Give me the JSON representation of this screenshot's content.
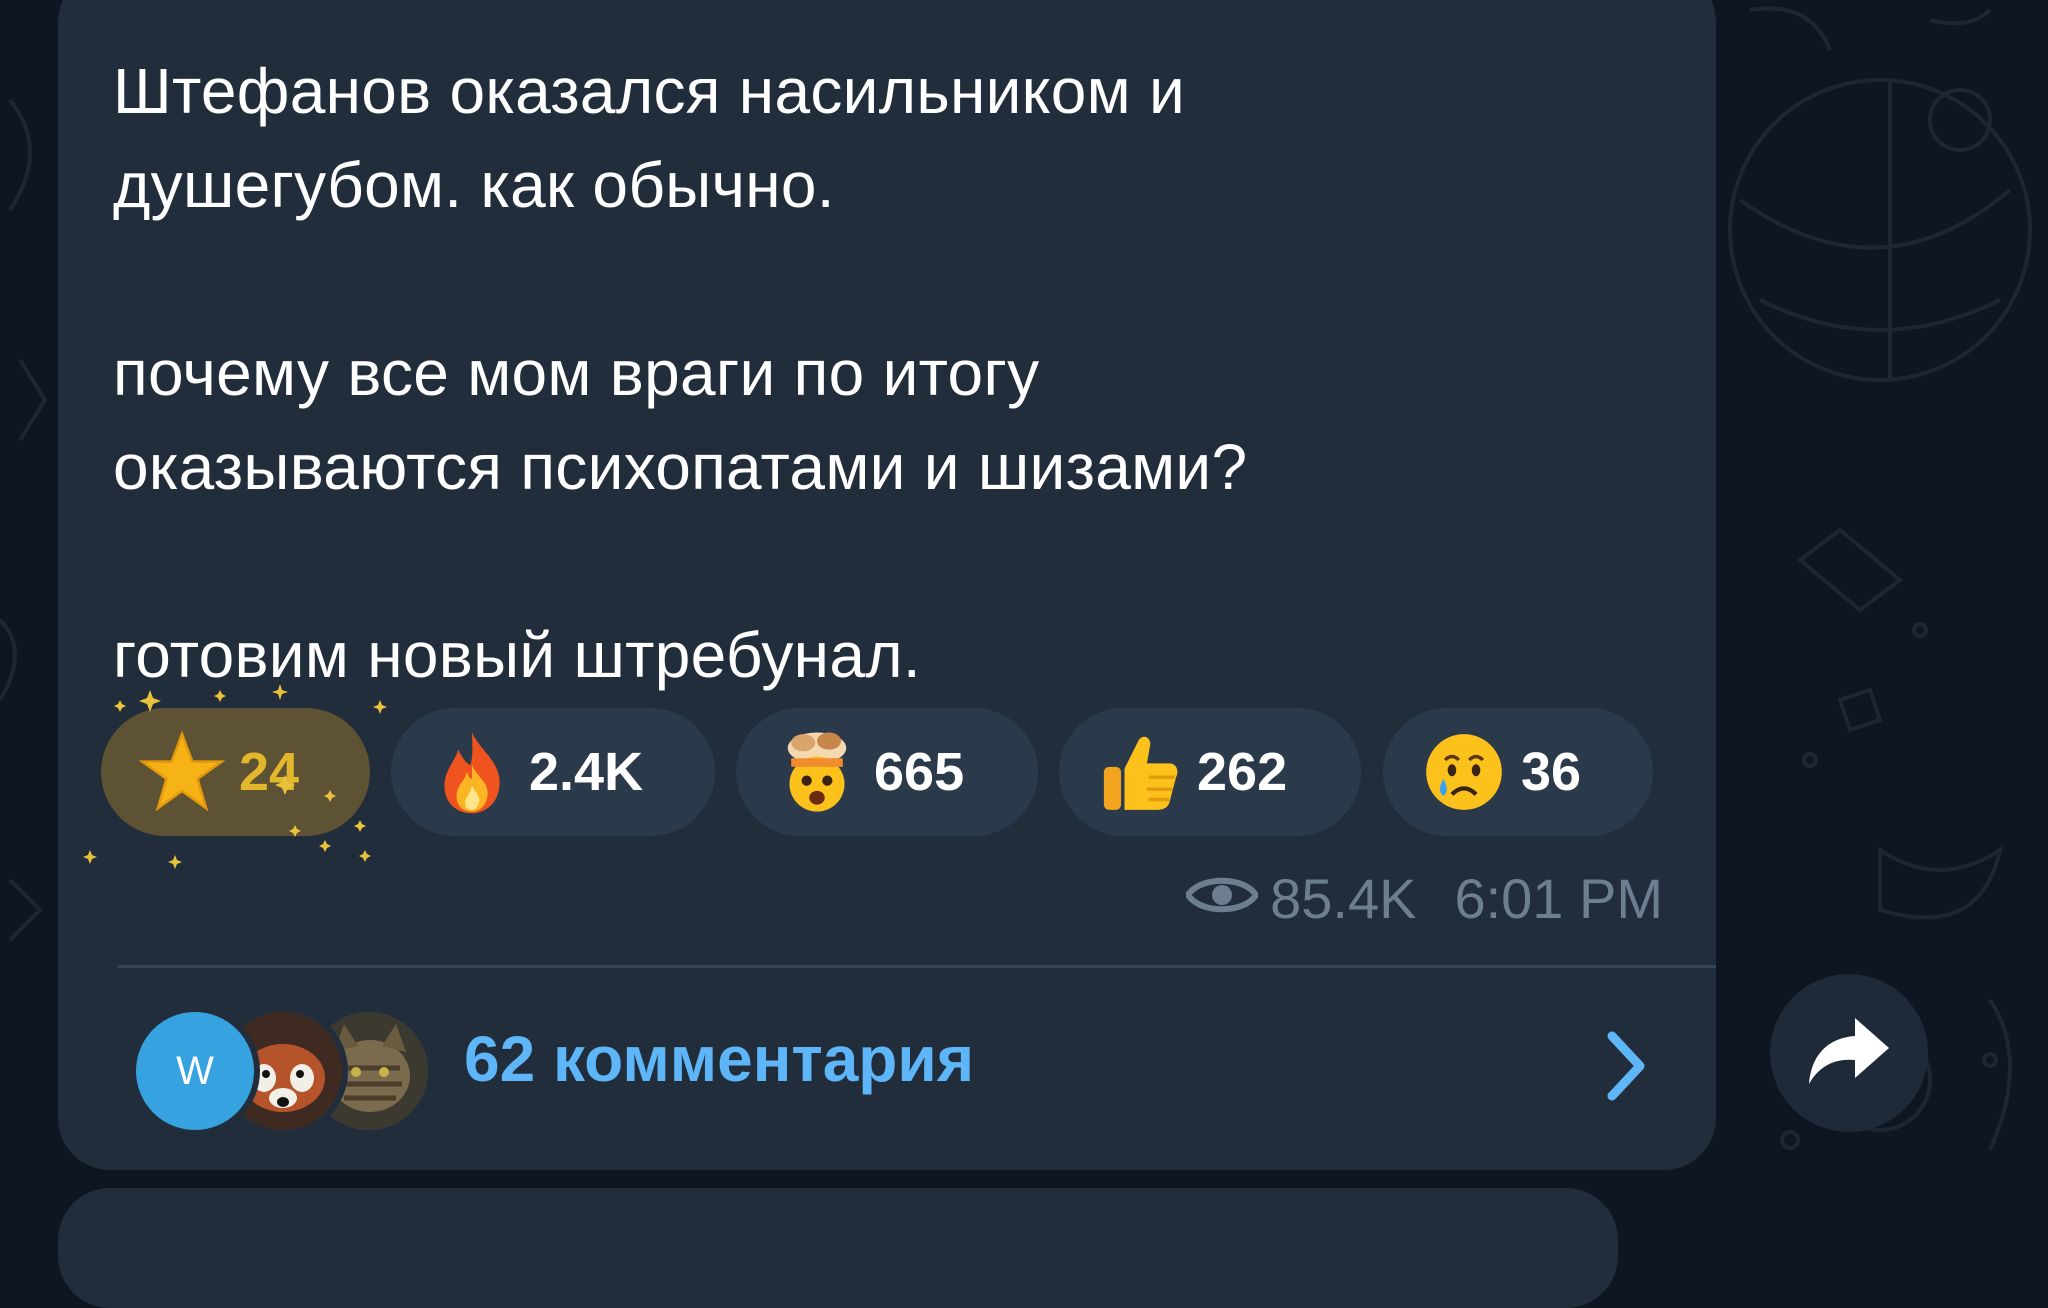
{
  "message": {
    "text": "Штефанов оказался насильником и\nдушегубом. как обычно.\n\nпочему все мом враги по итогу\nоказываются психопатами и шизами?\n\nготовим новый штребунал."
  },
  "reactions": [
    {
      "emoji": "star-icon",
      "count": "24"
    },
    {
      "emoji": "fire-icon",
      "count": "2.4K"
    },
    {
      "emoji": "exploding-head-icon",
      "count": "665"
    },
    {
      "emoji": "thumbs-up-icon",
      "count": "262"
    },
    {
      "emoji": "crying-face-icon",
      "count": "36"
    }
  ],
  "meta": {
    "views": "85.4K",
    "time": "6:01 PM"
  },
  "comments": {
    "avatar_initial": "W",
    "label": "62 комментария"
  },
  "colors": {
    "background": "#0e1621",
    "bubble": "#212d3b",
    "reaction_bg": "#2b3a4b",
    "star_reaction_bg": "#5e5234",
    "accent_blue": "#5eb5f7",
    "meta_gray": "#6d7f8f",
    "star_gold": "#e3b72b"
  }
}
